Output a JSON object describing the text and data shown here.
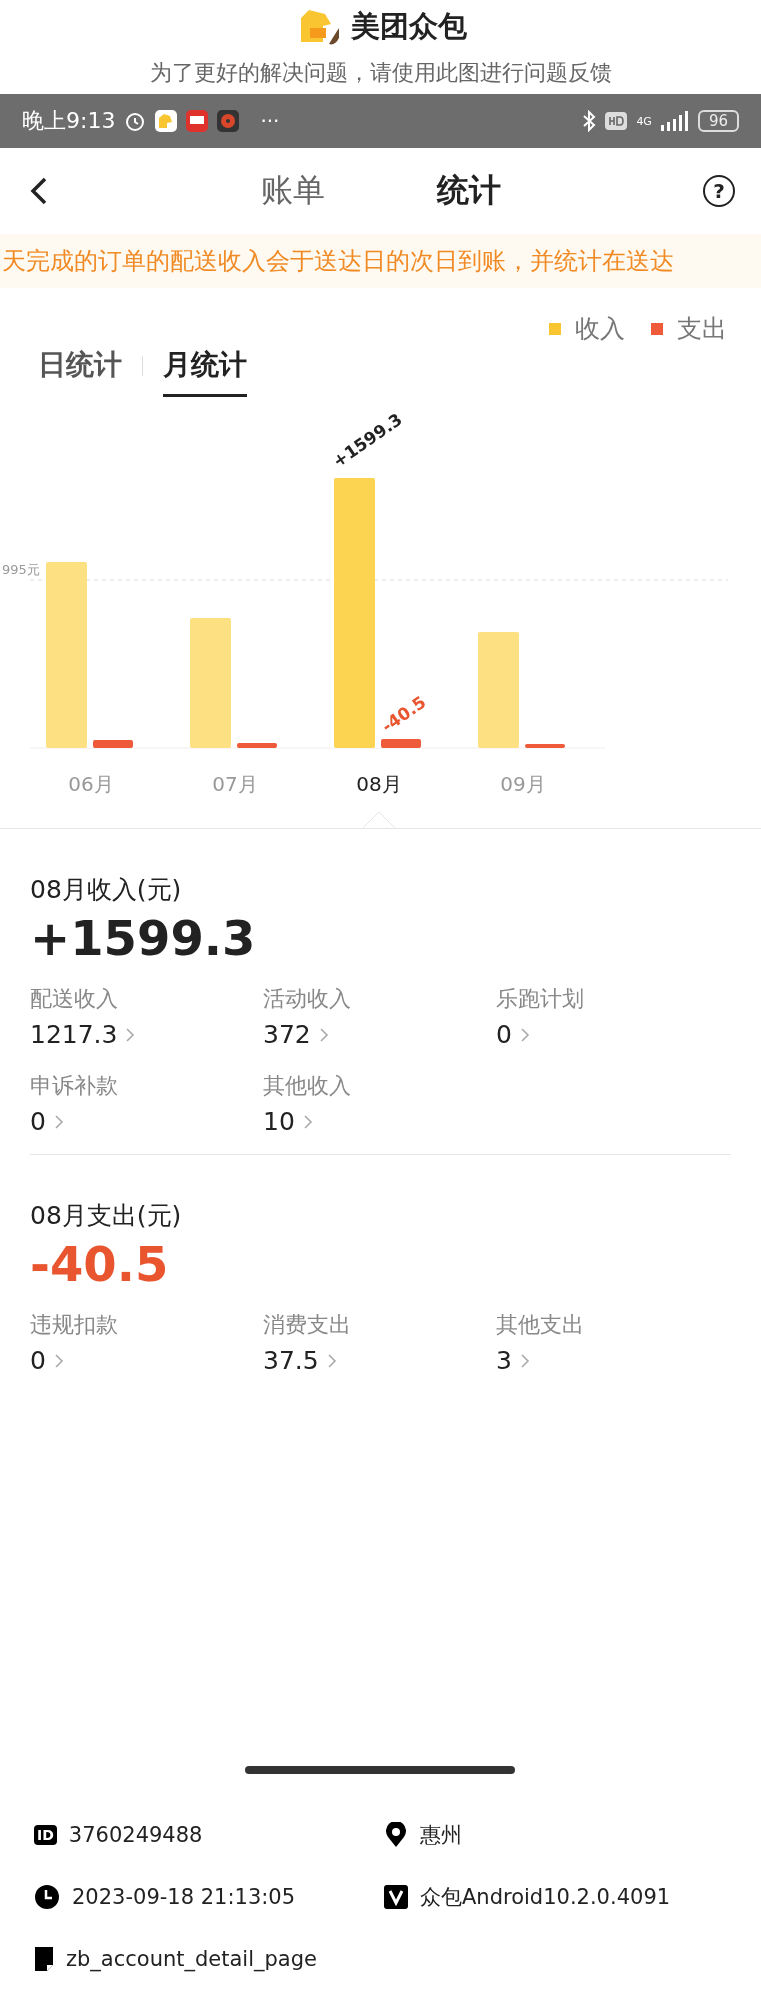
{
  "header": {
    "app_name": "美团众包",
    "subtitle": "为了更好的解决问题，请使用此图进行问题反馈"
  },
  "status_bar": {
    "time": "晚上9:13",
    "more": "···",
    "network": "4G",
    "battery": "96"
  },
  "nav": {
    "tabs": [
      {
        "label": "账单",
        "selected": false
      },
      {
        "label": "统计",
        "selected": true
      }
    ],
    "help": "?"
  },
  "notice": "天完成的订单的配送收入会于送达日的次日到账，并统计在送达",
  "legend": [
    {
      "label": "收入",
      "color": "#f9c531"
    },
    {
      "label": "支出",
      "color": "#ee5a3a"
    }
  ],
  "period_tabs": [
    {
      "label": "日统计",
      "selected": false
    },
    {
      "label": "月统计",
      "selected": true
    }
  ],
  "chart": {
    "reference_label": "995元",
    "income_label": "+1599.3",
    "expense_label": "-40.5",
    "months": [
      {
        "label": "06月",
        "selected": false
      },
      {
        "label": "07月",
        "selected": false
      },
      {
        "label": "08月",
        "selected": true
      },
      {
        "label": "09月",
        "selected": false
      }
    ]
  },
  "income": {
    "title": "08月收入(元)",
    "total": "+1599.3",
    "items": [
      {
        "label": "配送收入",
        "value": "1217.3"
      },
      {
        "label": "活动收入",
        "value": "372"
      },
      {
        "label": "乐跑计划",
        "value": "0"
      },
      {
        "label": "申诉补款",
        "value": "0"
      },
      {
        "label": "其他收入",
        "value": "10"
      }
    ]
  },
  "expense": {
    "title": "08月支出(元)",
    "total": "-40.5",
    "items": [
      {
        "label": "违规扣款",
        "value": "0"
      },
      {
        "label": "消费支出",
        "value": "37.5"
      },
      {
        "label": "其他支出",
        "value": "3"
      }
    ]
  },
  "footer": {
    "id_badge": "ID",
    "user_id": "3760249488",
    "city": "惠州",
    "timestamp": "2023-09-18 21:13:05",
    "version": "众包Android10.2.0.4091",
    "page": "zb_account_detail_page"
  }
}
